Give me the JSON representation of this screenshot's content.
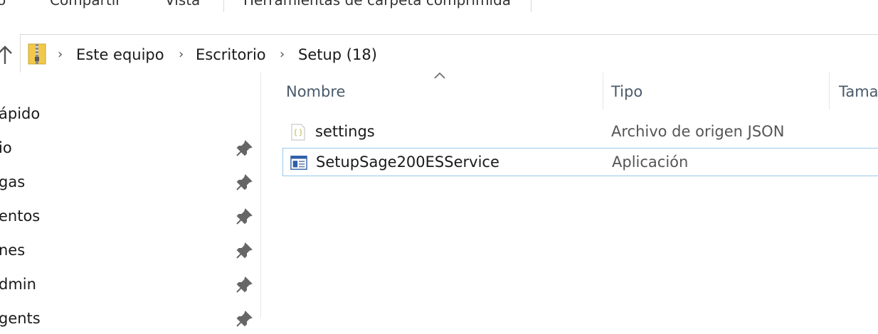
{
  "ribbon": {
    "tabs": [
      {
        "label": "o"
      },
      {
        "label": "Compartir"
      },
      {
        "label": "Vista"
      },
      {
        "label": "Herramientas de carpeta comprimida"
      }
    ]
  },
  "address": {
    "icon": "zip-folder-icon",
    "crumbs": [
      {
        "label": "Este equipo"
      },
      {
        "label": "Escritorio"
      },
      {
        "label": "Setup (18)"
      }
    ]
  },
  "navpane": {
    "items": [
      {
        "label": "ápido",
        "pinned": false
      },
      {
        "label": "io",
        "pinned": true
      },
      {
        "label": "gas",
        "pinned": true
      },
      {
        "label": "entos",
        "pinned": true
      },
      {
        "label": "nes",
        "pinned": true
      },
      {
        "label": "dmin",
        "pinned": true
      },
      {
        "label": "gents",
        "pinned": true
      }
    ]
  },
  "filelist": {
    "columns": {
      "name": "Nombre",
      "type": "Tipo",
      "size": "Tama"
    },
    "sort": {
      "column": "name",
      "direction": "ascending"
    },
    "files": [
      {
        "name": "settings",
        "type": "Archivo de origen JSON",
        "icon": "json-file-icon",
        "selected": false
      },
      {
        "name": "SetupSage200ESService",
        "type": "Aplicación",
        "icon": "application-icon",
        "selected": true
      }
    ]
  },
  "colors": {
    "selection_border": "#99c9ef",
    "header_text": "#4a5a6a"
  }
}
